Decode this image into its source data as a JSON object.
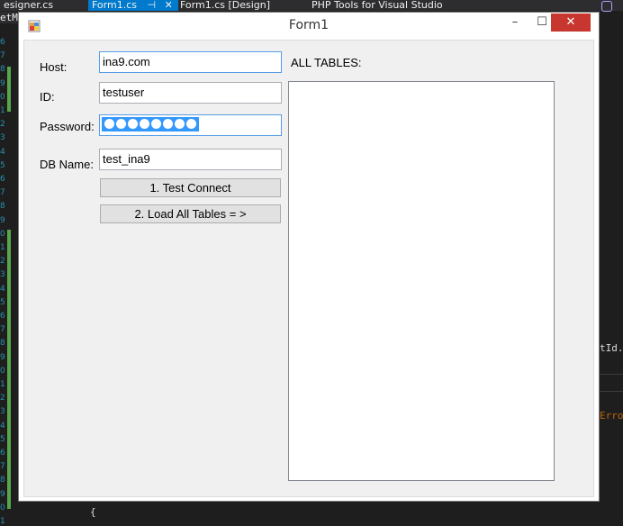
{
  "ide": {
    "tabs": [
      {
        "label": "esigner.cs",
        "active": false
      },
      {
        "label": "Form1.cs",
        "active": true
      },
      {
        "label": "Form1.cs [Design]",
        "active": false
      },
      {
        "label": "PHP Tools for Visual Studio",
        "active": false
      }
    ],
    "pin_glyph": "⊣",
    "close_glyph": "✕",
    "left_fragment": "etM",
    "code_fragments": {
      "right_1": "tId.",
      "right_2": "Erro",
      "bottom_brace": "{"
    },
    "gutter_numbers": [
      "6",
      "7",
      "8",
      "9",
      "0",
      "1",
      "2",
      "3",
      "4",
      "5",
      "6",
      "7",
      "8",
      "9",
      "0",
      "1",
      "2",
      "3",
      "4",
      "5",
      "6",
      "7",
      "8",
      "9",
      "0",
      "1",
      "2",
      "3",
      "4",
      "5",
      "6",
      "7",
      "8",
      "9",
      "0",
      "1"
    ]
  },
  "window": {
    "title": "Form1",
    "minimize_glyph": "–",
    "maximize_glyph": "☐",
    "close_glyph": "✕"
  },
  "form": {
    "host": {
      "label": "Host:",
      "value": "ina9.com"
    },
    "id": {
      "label": "ID:",
      "value": "testuser"
    },
    "password": {
      "label": "Password:",
      "mask_count": 8
    },
    "dbname": {
      "label": "DB Name:",
      "value": "test_ina9"
    },
    "test_connect_label": "1. Test Connect",
    "load_tables_label": "2. Load All Tables = >",
    "all_tables_label": "ALL TABLES:"
  },
  "colors": {
    "accent": "#007acc",
    "close": "#c7372f",
    "selection": "#3399ff"
  }
}
